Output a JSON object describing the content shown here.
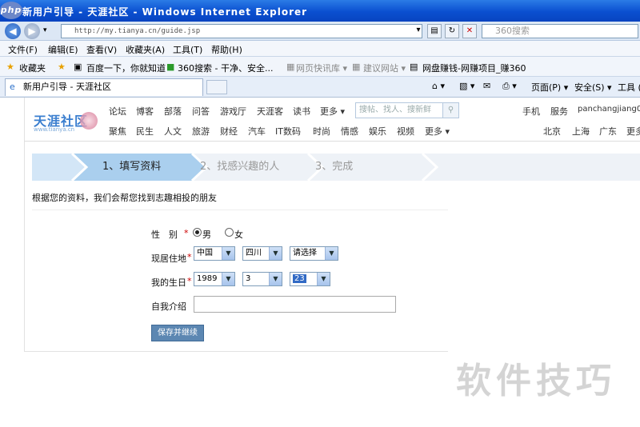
{
  "window": {
    "title": "新用户引导 - 天涯社区 - Windows Internet Explorer",
    "logo_text": "php"
  },
  "address": {
    "url": "http://my.tianya.cn/guide.jsp",
    "search_placeholder": "360搜索"
  },
  "menu": [
    "文件(F)",
    "编辑(E)",
    "查看(V)",
    "收藏夹(A)",
    "工具(T)",
    "帮助(H)"
  ],
  "favorites": {
    "label": "收藏夹",
    "items": [
      "百度一下，你就知道",
      "360搜索 - 干净、安全...",
      "网页快讯库 ▾",
      "建议网站 ▾",
      "网盘赚钱-网赚项目_赚360"
    ]
  },
  "tab": {
    "title": "新用户引导 - 天涯社区"
  },
  "tabtools": [
    "页面(P) ▾",
    "安全(S) ▾",
    "工具 (O) ▾"
  ],
  "site": {
    "logo_cn": "天涯社区",
    "logo_en": "www.tianya.cn",
    "nav_top": [
      "论坛",
      "博客",
      "部落",
      "问答",
      "游戏厅",
      "天涯客",
      "读书",
      "更多 ▾"
    ],
    "nav_bottom": [
      "聚焦",
      "民生",
      "人文",
      "旅游",
      "财经",
      "汽车",
      "IT数码",
      "时尚",
      "情感",
      "娱乐",
      "视频",
      "更多 ▾"
    ],
    "search_placeholder": "搜帖、找人、搜新鲜",
    "right_top": [
      "手机",
      "服务",
      "panchangjiang0"
    ],
    "right_bottom": [
      "北京",
      "上海",
      "广东",
      "更多"
    ]
  },
  "steps": [
    "1、填写资料",
    "2、找感兴趣的人",
    "3、完成"
  ],
  "intro_text": "根据您的资料，我们会帮您找到志趣相投的朋友",
  "form": {
    "gender_label": "性　别",
    "gender_options": [
      "男",
      "女"
    ],
    "gender_selected": "男",
    "residence_label": "现居住地",
    "residence": [
      "中国",
      "四川",
      "请选择"
    ],
    "birthday_label": "我的生日",
    "birthday": [
      "1989",
      "3",
      "23"
    ],
    "bio_label": "自我介绍",
    "bio_value": "",
    "required_mark": "*",
    "submit_label": "保存并继续"
  },
  "watermark": "软件技巧",
  "colors": {
    "titlebar": "#0a4fd0",
    "accent": "#3a7ecf",
    "step_active": "#d3e6f7",
    "submit": "#5c87b2"
  }
}
